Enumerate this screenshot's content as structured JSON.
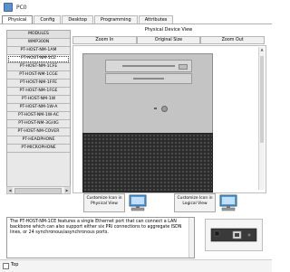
{
  "window": {
    "title": "PC0"
  },
  "tabs": [
    "Physical",
    "Config",
    "Desktop",
    "Programming",
    "Attributes"
  ],
  "modules": {
    "items": [
      "MODULES",
      "WMP300N",
      "PT-HOST-NM-1AM",
      "PT-HOST-NM-1CE",
      "PT-HOST-NM-1CFE",
      "PT-HOST-NM-1CGE",
      "PT-HOST-NM-1FFE",
      "PT-HOST-NM-1FGE",
      "PT-HOST-NM-1W",
      "PT-HOST-NM-1W-A",
      "PT-HOST-NM-1W-AC",
      "PT-HOST-NM-3G/4G",
      "PT-HOST-NM-COVER",
      "PT-HEADPHONE",
      "PT-MICROPHONE"
    ],
    "selected": "PT-HOST-NM-1CE"
  },
  "physical_view": {
    "title": "Physical Device View",
    "zoom_in": "Zoom In",
    "original_size": "Original Size",
    "zoom_out": "Zoom Out"
  },
  "customize": {
    "physical": "Customize Icon in Physical View",
    "logical": "Customize Icon in Logical View"
  },
  "description": "The PT-HOST-NM-1CE features a single Ethernet port that can connect a LAN backbone which can also support either six PRI connections to aggregate ISDN lines, or 24 synchronous/asynchronous ports.",
  "bottom": {
    "top_label": "Top"
  },
  "colors": {
    "accent": "#3a78c8",
    "case": "#c4c4c4",
    "grill": "#2d2d2d"
  }
}
